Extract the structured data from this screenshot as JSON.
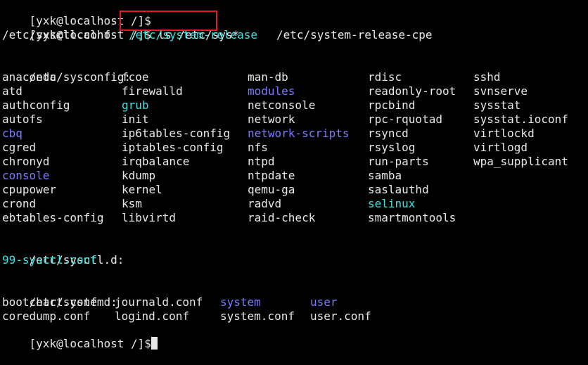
{
  "terminal": {
    "prompt": "[yxk@localhost /]$",
    "command": " ls /etc/sys*",
    "highlight_color": "#e02020",
    "colors": {
      "plain": "#e8e8e8",
      "directory": "#7b7bff",
      "symlink": "#3ee0e0"
    },
    "top_files": [
      {
        "name": "/etc/sysctl.conf",
        "kind": "plain"
      },
      {
        "name": "/etc/system-release",
        "kind": "symlink"
      },
      {
        "name": "/etc/system-release-cpe",
        "kind": "plain"
      }
    ],
    "sysconfig_header": "/etc/sysconfig:",
    "sysconfig_rows": [
      [
        {
          "name": "anaconda",
          "kind": "plain"
        },
        {
          "name": "fcoe",
          "kind": "plain"
        },
        {
          "name": "man-db",
          "kind": "plain"
        },
        {
          "name": "rdisc",
          "kind": "plain"
        },
        {
          "name": "sshd",
          "kind": "plain"
        }
      ],
      [
        {
          "name": "atd",
          "kind": "plain"
        },
        {
          "name": "firewalld",
          "kind": "plain"
        },
        {
          "name": "modules",
          "kind": "directory"
        },
        {
          "name": "readonly-root",
          "kind": "plain"
        },
        {
          "name": "svnserve",
          "kind": "plain"
        }
      ],
      [
        {
          "name": "authconfig",
          "kind": "plain"
        },
        {
          "name": "grub",
          "kind": "symlink"
        },
        {
          "name": "netconsole",
          "kind": "plain"
        },
        {
          "name": "rpcbind",
          "kind": "plain"
        },
        {
          "name": "sysstat",
          "kind": "plain"
        }
      ],
      [
        {
          "name": "autofs",
          "kind": "plain"
        },
        {
          "name": "init",
          "kind": "plain"
        },
        {
          "name": "network",
          "kind": "plain"
        },
        {
          "name": "rpc-rquotad",
          "kind": "plain"
        },
        {
          "name": "sysstat.ioconf",
          "kind": "plain"
        }
      ],
      [
        {
          "name": "cbq",
          "kind": "directory"
        },
        {
          "name": "ip6tables-config",
          "kind": "plain"
        },
        {
          "name": "network-scripts",
          "kind": "directory"
        },
        {
          "name": "rsyncd",
          "kind": "plain"
        },
        {
          "name": "virtlockd",
          "kind": "plain"
        }
      ],
      [
        {
          "name": "cgred",
          "kind": "plain"
        },
        {
          "name": "iptables-config",
          "kind": "plain"
        },
        {
          "name": "nfs",
          "kind": "plain"
        },
        {
          "name": "rsyslog",
          "kind": "plain"
        },
        {
          "name": "virtlogd",
          "kind": "plain"
        }
      ],
      [
        {
          "name": "chronyd",
          "kind": "plain"
        },
        {
          "name": "irqbalance",
          "kind": "plain"
        },
        {
          "name": "ntpd",
          "kind": "plain"
        },
        {
          "name": "run-parts",
          "kind": "plain"
        },
        {
          "name": "wpa_supplicant",
          "kind": "plain"
        }
      ],
      [
        {
          "name": "console",
          "kind": "directory"
        },
        {
          "name": "kdump",
          "kind": "plain"
        },
        {
          "name": "ntpdate",
          "kind": "plain"
        },
        {
          "name": "samba",
          "kind": "plain"
        }
      ],
      [
        {
          "name": "cpupower",
          "kind": "plain"
        },
        {
          "name": "kernel",
          "kind": "plain"
        },
        {
          "name": "qemu-ga",
          "kind": "plain"
        },
        {
          "name": "saslauthd",
          "kind": "plain"
        }
      ],
      [
        {
          "name": "crond",
          "kind": "plain"
        },
        {
          "name": "ksm",
          "kind": "plain"
        },
        {
          "name": "radvd",
          "kind": "plain"
        },
        {
          "name": "selinux",
          "kind": "symlink"
        }
      ],
      [
        {
          "name": "ebtables-config",
          "kind": "plain"
        },
        {
          "name": "libvirtd",
          "kind": "plain"
        },
        {
          "name": "raid-check",
          "kind": "plain"
        },
        {
          "name": "smartmontools",
          "kind": "plain"
        }
      ]
    ],
    "sysctld_header": "/etc/sysctl.d:",
    "sysctld_files": [
      {
        "name": "99-sysctl.conf",
        "kind": "symlink"
      }
    ],
    "systemd_header": "/etc/systemd:",
    "systemd_rows": [
      [
        {
          "name": "bootchart.conf",
          "kind": "plain"
        },
        {
          "name": "journald.conf",
          "kind": "plain"
        },
        {
          "name": "system",
          "kind": "directory"
        },
        {
          "name": "user",
          "kind": "directory"
        }
      ],
      [
        {
          "name": "coredump.conf",
          "kind": "plain"
        },
        {
          "name": "logind.conf",
          "kind": "plain"
        },
        {
          "name": "system.conf",
          "kind": "plain"
        },
        {
          "name": "user.conf",
          "kind": "plain"
        }
      ]
    ]
  }
}
